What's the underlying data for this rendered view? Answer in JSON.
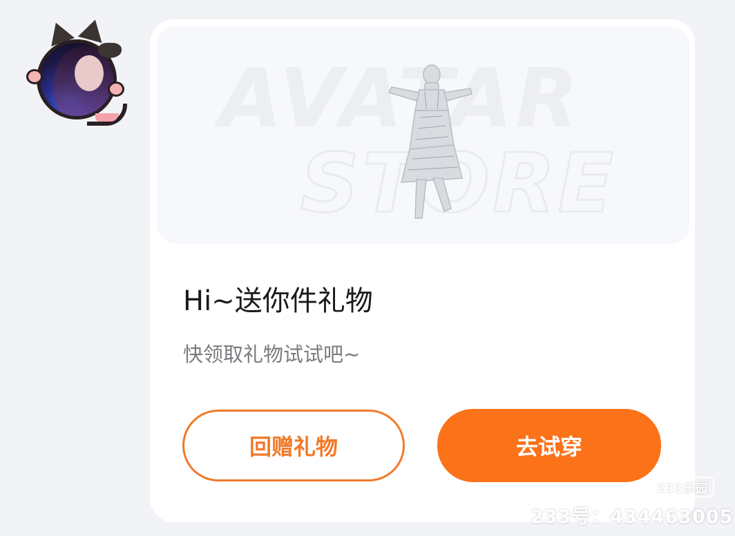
{
  "sender": {
    "avatar_icon": "user-avatar-cat-frame"
  },
  "card": {
    "banner": {
      "word1": "AVATAR",
      "word2": "STORE",
      "figure_icon": "avatar-outfit-figure"
    },
    "title": "Hi~送你件礼物",
    "subtitle": "快领取礼物试试吧~",
    "buttons": {
      "return_gift_label": "回赠礼物",
      "try_on_label": "去试穿"
    }
  },
  "watermark": {
    "badge": "233乐园",
    "id_text": "233号：434463005"
  },
  "colors": {
    "accent": "#fb7219",
    "outline": "#f07a2a",
    "background": "#f2f3f7",
    "card": "#ffffff",
    "title_text": "#1a1a1a",
    "subtitle_text": "#7a7a80"
  }
}
